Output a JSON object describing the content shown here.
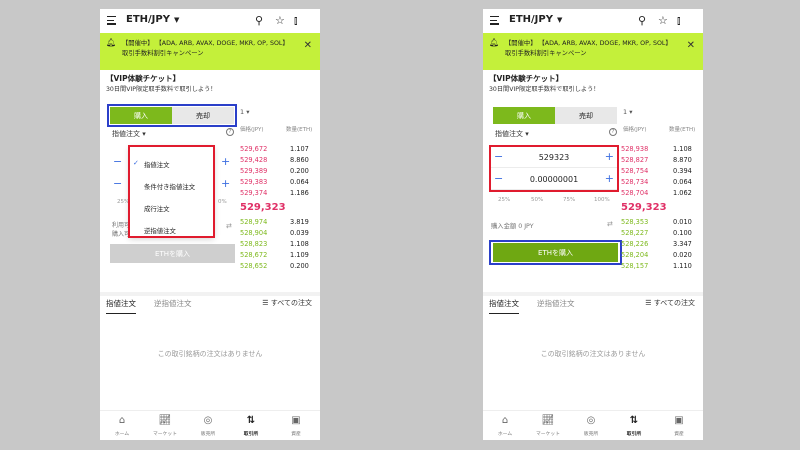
{
  "pair": "ETH/JPY",
  "banner": {
    "text": "【開催中】 【ADA, ARB, AVAX, DOGE, MKR, OP, SOL】取引手数料割引キャンペーン"
  },
  "vip": {
    "title": "【VIP体験チケット】",
    "subtitle": "30日間VIP限定取手数料で取引しよう！"
  },
  "side_tabs": {
    "buy": "購入",
    "sell": "売却"
  },
  "multiplier": "1 ▾",
  "order_type": {
    "label": "指値注文 ▾"
  },
  "orderbook": {
    "price_header": "価格(JPY)",
    "qty_header": "数量(ETH)",
    "left": {
      "asks": [
        {
          "price": "529,672",
          "qty": "1.107"
        },
        {
          "price": "529,428",
          "qty": "8.860"
        },
        {
          "price": "529,389",
          "qty": "0.200"
        },
        {
          "price": "529,383",
          "qty": "0.064"
        },
        {
          "price": "529,374",
          "qty": "1.186"
        }
      ],
      "mid": "529,323",
      "bids": [
        {
          "price": "528,974",
          "qty": "3.819"
        },
        {
          "price": "528,904",
          "qty": "0.039"
        },
        {
          "price": "528,823",
          "qty": "1.108"
        },
        {
          "price": "528,672",
          "qty": "1.109"
        },
        {
          "price": "528,652",
          "qty": "0.200"
        }
      ]
    },
    "right": {
      "asks": [
        {
          "price": "528,938",
          "qty": "1.108"
        },
        {
          "price": "528,827",
          "qty": "8.870"
        },
        {
          "price": "528,754",
          "qty": "0.394"
        },
        {
          "price": "528,734",
          "qty": "0.064"
        },
        {
          "price": "528,704",
          "qty": "1.062"
        }
      ],
      "mid": "529,323",
      "bids": [
        {
          "price": "528,353",
          "qty": "0.010"
        },
        {
          "price": "528,227",
          "qty": "0.100"
        },
        {
          "price": "528,226",
          "qty": "3.347"
        },
        {
          "price": "528,204",
          "qty": "0.020"
        },
        {
          "price": "528,157",
          "qty": "1.110"
        }
      ]
    }
  },
  "dropdown": {
    "items": [
      "指値注文",
      "条件付き指値注文",
      "成行注文",
      "逆指値注文"
    ],
    "selected_index": 0
  },
  "left_partial": {
    "pct_fragment": "25%",
    "pct_fragment2": "0%",
    "amount_fragment1": "利用可",
    "amount_fragment2": "購入可",
    "button": "ETHを購入"
  },
  "form": {
    "price": "529323",
    "quantity": "0.00000001",
    "percentages": [
      "25%",
      "50%",
      "75%",
      "100%"
    ],
    "amount_label": "購入金額 0 JPY",
    "submit": "ETHを購入"
  },
  "order_tabs": {
    "active": "指値注文",
    "inactive": "逆指値注文",
    "all_orders": "☰ すべての注文"
  },
  "empty_message": "この取引銘柄の注文はありません",
  "nav": [
    "ホーム",
    "マーケット",
    "販売所",
    "取引所",
    "資産"
  ],
  "colors": {
    "accent_green": "#7db91c",
    "sell_red": "#e03167",
    "banner_lime": "#c4f03a",
    "highlight_blue": "#2b3fc9",
    "highlight_red": "#e01b2e"
  }
}
